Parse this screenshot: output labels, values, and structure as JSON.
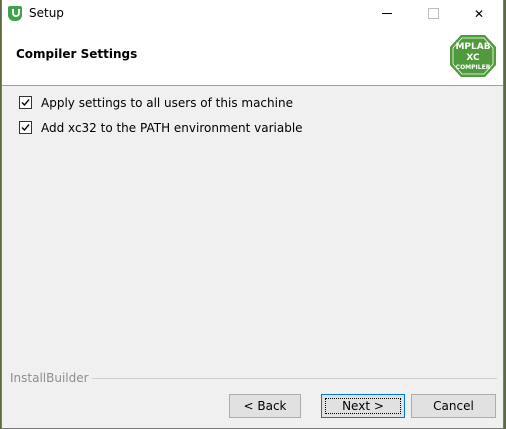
{
  "window": {
    "title": "Setup",
    "controls": {
      "minimize": "minimize",
      "maximize": "maximize",
      "close": "✕"
    }
  },
  "header": {
    "title": "Compiler Settings",
    "logo": {
      "line1": "MPLAB",
      "line2": "XC",
      "line3": "COMPILER"
    }
  },
  "options": [
    {
      "label": "Apply settings to all users of this machine",
      "checked": true
    },
    {
      "label": "Add xc32 to the PATH environment variable",
      "checked": true
    }
  ],
  "footer": {
    "brand": "InstallBuilder",
    "back_label": "< Back",
    "next_label": "Next >",
    "cancel_label": "Cancel"
  },
  "colors": {
    "logo_green": "#4f9a3a",
    "accent": "#0078d7"
  }
}
